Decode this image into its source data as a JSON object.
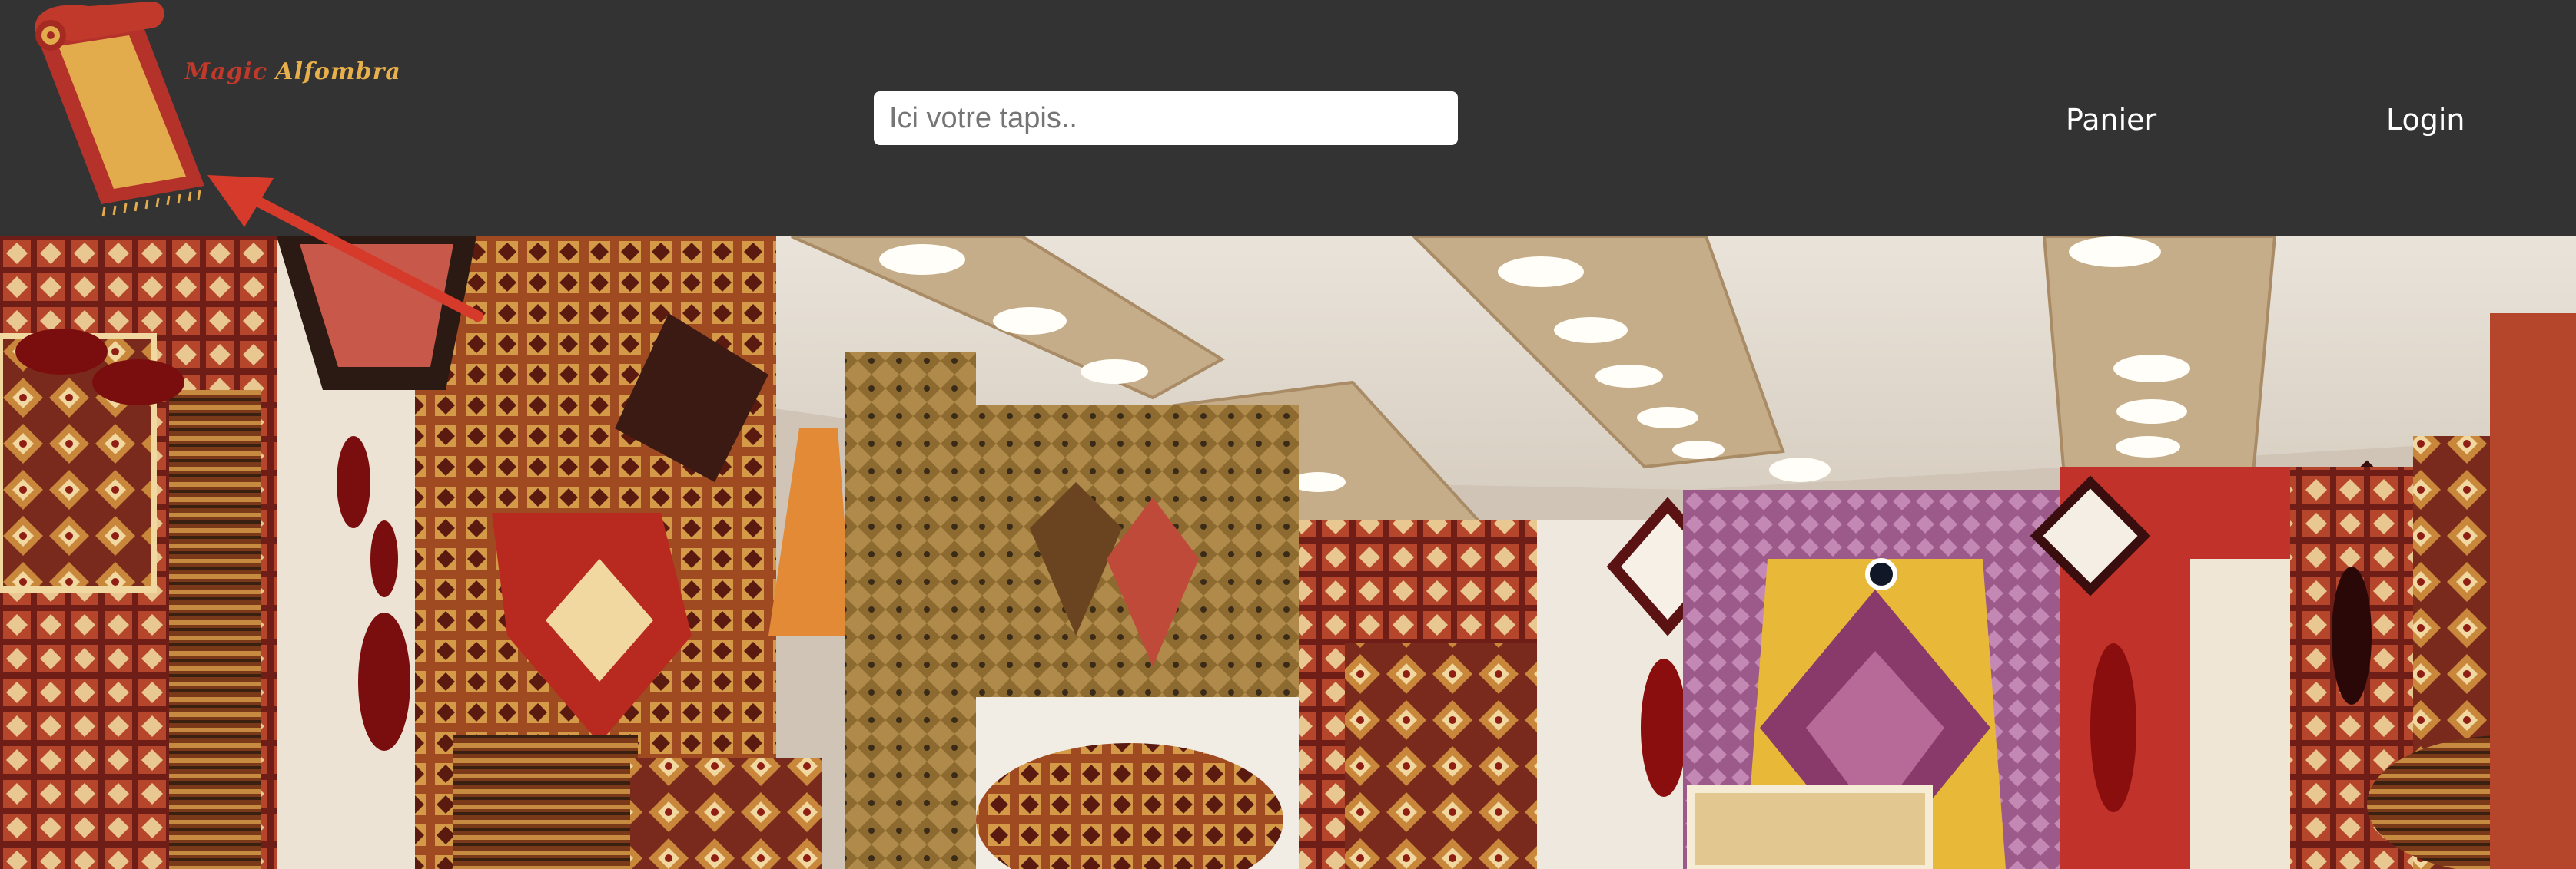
{
  "logo": {
    "word1": "Magic",
    "word2": "Alfombra",
    "icon": "rolled-carpet-icon",
    "colors": {
      "red": "#c0392b",
      "gold": "#e8b04a"
    }
  },
  "search": {
    "placeholder": "Ici votre tapis..",
    "value": ""
  },
  "nav": {
    "cart_label": "Panier",
    "login_label": "Login"
  },
  "hero": {
    "image": "carpet-shop-interior-photo"
  },
  "annotation": {
    "icon": "red-arrow-icon",
    "color": "#d63a2a"
  },
  "colors": {
    "header_bg": "#333333",
    "text": "#ffffff"
  }
}
